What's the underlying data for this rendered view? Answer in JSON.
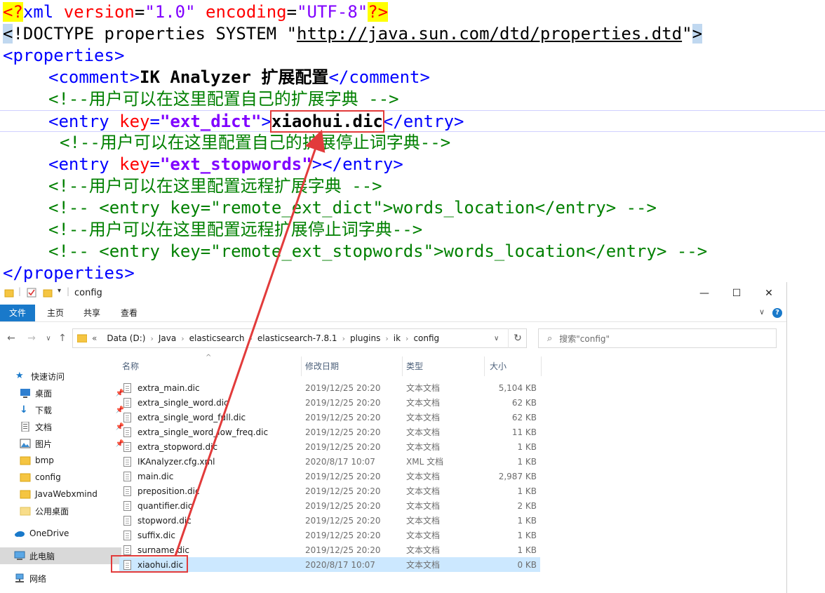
{
  "editor": {
    "line1": {
      "pi_open": "<?",
      "name": "xml",
      "a1": "version",
      "v1": "\"1.0\"",
      "a2": "encoding",
      "v2": "\"UTF-8\"",
      "pi_close": "?>"
    },
    "line2": {
      "open": "<",
      "doctype": "!DOCTYPE properties SYSTEM \"",
      "url": "http://java.sun.com/dtd/properties.dtd",
      "end": "\"",
      "close": ">"
    },
    "line3": "<properties>",
    "line4": {
      "open": "<comment>",
      "text": "IK Analyzer 扩展配置",
      "close": "</comment>"
    },
    "line5": "<!--用户可以在这里配置自己的扩展字典 -->",
    "line6": {
      "open": "<entry",
      "attr": "key",
      "eq": "=",
      "val": "\"ext_dict\"",
      "gt": ">",
      "text": "xiaohui.dic",
      "close": "</entry>"
    },
    "line7": "<!--用户可以在这里配置自己的扩展停止词字典-->",
    "line8": {
      "open": "<entry",
      "attr": "key",
      "eq": "=",
      "val": "\"ext_stopwords\"",
      "gt": ">",
      "close": "</entry>"
    },
    "line9": "<!--用户可以在这里配置远程扩展字典 -->",
    "line10": "<!-- <entry key=\"remote_ext_dict\">words_location</entry> -->",
    "line11": "<!--用户可以在这里配置远程扩展停止词字典-->",
    "line12": "<!-- <entry key=\"remote_ext_stopwords\">words_location</entry> -->",
    "line13": "</properties>"
  },
  "explorer": {
    "title": "config",
    "window_buttons": {
      "minimize": "—",
      "maximize": "☐",
      "close": "✕"
    },
    "ribbon_tabs": [
      "文件",
      "主页",
      "共享",
      "查看"
    ],
    "address": {
      "prefix": "«",
      "segments": [
        "Data (D:)",
        "Java",
        "elasticsearch",
        "elasticsearch-7.8.1",
        "plugins",
        "ik",
        "config"
      ]
    },
    "search_placeholder": "搜索\"config\"",
    "nav": [
      {
        "label": "快速访问",
        "icon": "star-icon",
        "pinned": false
      },
      {
        "label": "桌面",
        "icon": "desktop-icon",
        "pinned": true
      },
      {
        "label": "下载",
        "icon": "download-icon",
        "pinned": true
      },
      {
        "label": "文档",
        "icon": "document-icon",
        "pinned": true
      },
      {
        "label": "图片",
        "icon": "picture-icon",
        "pinned": true
      },
      {
        "label": "bmp",
        "icon": "folder-icon",
        "pinned": false
      },
      {
        "label": "config",
        "icon": "folder-icon",
        "pinned": false
      },
      {
        "label": "JavaWebxmind",
        "icon": "folder-icon",
        "pinned": false
      },
      {
        "label": "公用桌面",
        "icon": "folder-icon",
        "pinned": false
      },
      {
        "label": "OneDrive",
        "icon": "cloud-icon",
        "pinned": false
      },
      {
        "label": "此电脑",
        "icon": "computer-icon",
        "pinned": false
      },
      {
        "label": "网络",
        "icon": "network-icon",
        "pinned": false
      }
    ],
    "columns": {
      "name": "名称",
      "date": "修改日期",
      "type": "类型",
      "size": "大小"
    },
    "files": [
      {
        "name": "extra_main.dic",
        "date": "2019/12/25 20:20",
        "type": "文本文档",
        "size": "5,104 KB"
      },
      {
        "name": "extra_single_word.dic",
        "date": "2019/12/25 20:20",
        "type": "文本文档",
        "size": "62 KB"
      },
      {
        "name": "extra_single_word_full.dic",
        "date": "2019/12/25 20:20",
        "type": "文本文档",
        "size": "62 KB"
      },
      {
        "name": "extra_single_word_low_freq.dic",
        "date": "2019/12/25 20:20",
        "type": "文本文档",
        "size": "11 KB"
      },
      {
        "name": "extra_stopword.dic",
        "date": "2019/12/25 20:20",
        "type": "文本文档",
        "size": "1 KB"
      },
      {
        "name": "IKAnalyzer.cfg.xml",
        "date": "2020/8/17 10:07",
        "type": "XML 文档",
        "size": "1 KB"
      },
      {
        "name": "main.dic",
        "date": "2019/12/25 20:20",
        "type": "文本文档",
        "size": "2,987 KB"
      },
      {
        "name": "preposition.dic",
        "date": "2019/12/25 20:20",
        "type": "文本文档",
        "size": "1 KB"
      },
      {
        "name": "quantifier.dic",
        "date": "2019/12/25 20:20",
        "type": "文本文档",
        "size": "2 KB"
      },
      {
        "name": "stopword.dic",
        "date": "2019/12/25 20:20",
        "type": "文本文档",
        "size": "1 KB"
      },
      {
        "name": "suffix.dic",
        "date": "2019/12/25 20:20",
        "type": "文本文档",
        "size": "1 KB"
      },
      {
        "name": "surname.dic",
        "date": "2019/12/25 20:20",
        "type": "文本文档",
        "size": "1 KB"
      },
      {
        "name": "xiaohui.dic",
        "date": "2020/8/17 10:07",
        "type": "文本文档",
        "size": "0 KB"
      }
    ]
  },
  "colors": {
    "annotation": "#e23b3b",
    "ribbon_active": "#1979ca",
    "selection": "#cce8ff"
  }
}
